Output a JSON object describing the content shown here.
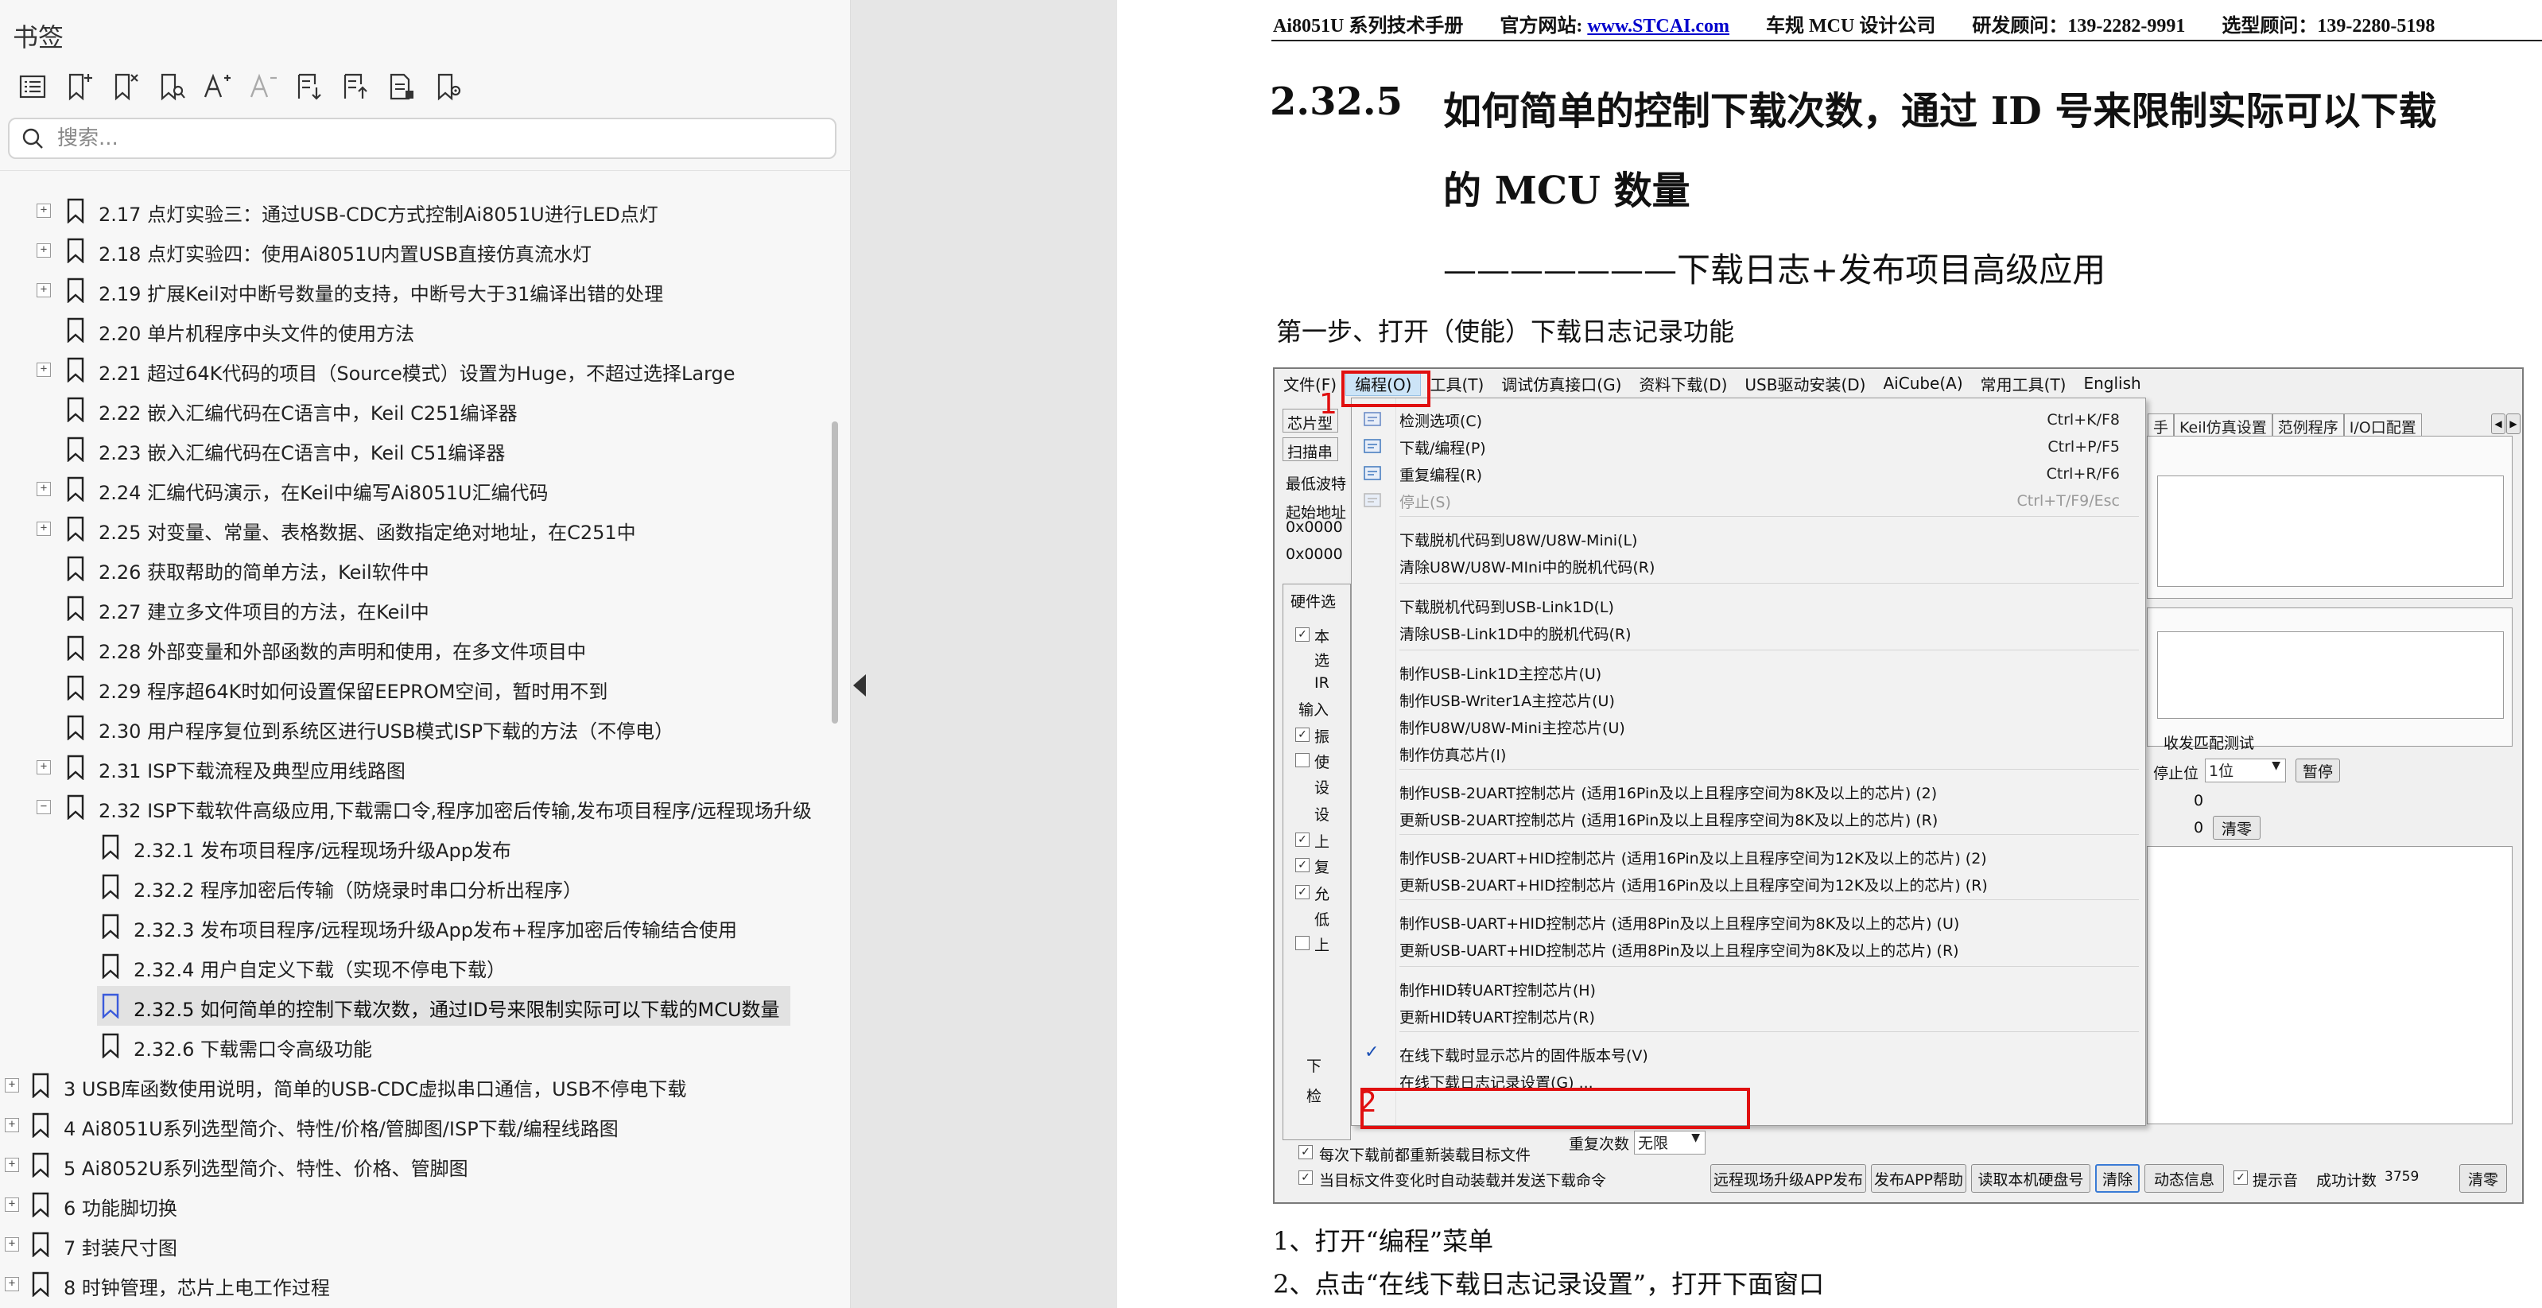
{
  "sidebar": {
    "title": "书签",
    "search_placeholder": "搜索...",
    "toolbar_icons": [
      "outline-list-icon",
      "add-bookmark-icon",
      "delete-bookmark-icon",
      "find-bookmark-icon",
      "increase-font-icon",
      "decrease-font-icon",
      "expand-all-icon",
      "collapse-all-icon",
      "bookmark-properties-icon",
      "bookmark-settings-icon"
    ],
    "items": [
      {
        "label": "2.17  点灯实验三：通过USB-CDC方式控制Ai8051U进行LED点灯",
        "level": 1,
        "expander": "+"
      },
      {
        "label": "2.18  点灯实验四：使用Ai8051U内置USB直接仿真流水灯",
        "level": 1,
        "expander": "+"
      },
      {
        "label": "2.19  扩展Keil对中断号数量的支持，中断号大于31编译出错的处理",
        "level": 1,
        "expander": "+"
      },
      {
        "label": "2.20  单片机程序中头文件的使用方法",
        "level": 1,
        "expander": ""
      },
      {
        "label": "2.21  超过64K代码的项目（Source模式）设置为Huge，不超过选择Large",
        "level": 1,
        "expander": "+"
      },
      {
        "label": "2.22  嵌入汇编代码在C语言中，Keil C251编译器",
        "level": 1,
        "expander": ""
      },
      {
        "label": "2.23  嵌入汇编代码在C语言中，Keil C51编译器",
        "level": 1,
        "expander": ""
      },
      {
        "label": "2.24  汇编代码演示，在Keil中编写Ai8051U汇编代码",
        "level": 1,
        "expander": "+"
      },
      {
        "label": "2.25  对变量、常量、表格数据、函数指定绝对地址，在C251中",
        "level": 1,
        "expander": "+"
      },
      {
        "label": "2.26  获取帮助的简单方法，Keil软件中",
        "level": 1,
        "expander": ""
      },
      {
        "label": "2.27  建立多文件项目的方法，在Keil中",
        "level": 1,
        "expander": ""
      },
      {
        "label": "2.28 外部变量和外部函数的声明和使用，在多文件项目中",
        "level": 1,
        "expander": ""
      },
      {
        "label": "2.29  程序超64K时如何设置保留EEPROM空间，暂时用不到",
        "level": 1,
        "expander": ""
      },
      {
        "label": "2.30  用户程序复位到系统区进行USB模式ISP下载的方法（不停电）",
        "level": 1,
        "expander": ""
      },
      {
        "label": "2.31  ISP下载流程及典型应用线路图",
        "level": 1,
        "expander": "+"
      },
      {
        "label": "2.32  ISP下载软件高级应用,下载需口令,程序加密后传输,发布项目程序/远程现场升级",
        "level": 1,
        "expander": "−"
      },
      {
        "label": "2.32.1 发布项目程序/远程现场升级App发布",
        "level": 2,
        "expander": ""
      },
      {
        "label": "2.32.2 程序加密后传输（防烧录时串口分析出程序）",
        "level": 2,
        "expander": ""
      },
      {
        "label": "2.32.3  发布项目程序/远程现场升级App发布+程序加密后传输结合使用",
        "level": 2,
        "expander": ""
      },
      {
        "label": "2.32.4 用户自定义下载（实现不停电下载）",
        "level": 2,
        "expander": ""
      },
      {
        "label": "2.32.5  如何简单的控制下载次数，通过ID号来限制实际可以下载的MCU数量",
        "level": 2,
        "expander": "",
        "selected": true
      },
      {
        "label": "2.32.6  下载需口令高级功能",
        "level": 2,
        "expander": ""
      },
      {
        "label": "3  USB库函数使用说明，简单的USB-CDC虚拟串口通信，USB不停电下载",
        "level": 0,
        "expander": "+"
      },
      {
        "label": "4  Ai8051U系列选型简介、特性/价格/管脚图/ISP下载/编程线路图",
        "level": 0,
        "expander": "+"
      },
      {
        "label": "5  Ai8052U系列选型简介、特性、价格、管脚图",
        "level": 0,
        "expander": "+"
      },
      {
        "label": "6  功能脚切换",
        "level": 0,
        "expander": "+"
      },
      {
        "label": "7  封装尺寸图",
        "level": 0,
        "expander": "+"
      },
      {
        "label": "8  时钟管理，芯片上电工作过程",
        "level": 0,
        "expander": "+"
      }
    ]
  },
  "doc": {
    "header": {
      "manual": "Ai8051U 系列技术手册",
      "site_label": "官方网站:",
      "site_url": "www.STCAI.com",
      "company": "车规 MCU 设计公司",
      "rd_phone": "研发顾问：139-2282-9991",
      "sel_phone": "选型顾问：139-2280-5198"
    },
    "section_number": "2.32.5",
    "title_line1": "如何简单的控制下载次数，通过 ID 号来限制实际可以下载",
    "title_line2": "的 MCU 数量",
    "subtitle": "———————下载日志+发布项目高级应用",
    "step1": "第一步、打开（使能）下载日志记录功能",
    "footnote1": "1、打开“编程”菜单",
    "footnote2": "2、点击“在线下载日志记录设置”，打开下面窗口"
  },
  "screenshot": {
    "menubar": [
      "文件(F)",
      "编程(O)",
      "工具(T)",
      "调试仿真接口(G)",
      "资料下载(D)",
      "USB驱动安装(D)",
      "AiCube(A)",
      "常用工具(T)",
      "English"
    ],
    "menu_items": [
      {
        "label": "检测选项(C)",
        "shortcut": "Ctrl+K/F8"
      },
      {
        "label": "下载/编程(P)",
        "shortcut": "Ctrl+P/F5"
      },
      {
        "label": "重复编程(R)",
        "shortcut": "Ctrl+R/F6"
      },
      {
        "label": "停止(S)",
        "shortcut": "Ctrl+T/F9/Esc",
        "disabled": true
      },
      {
        "label": "下载脱机代码到U8W/U8W-Mini(L)"
      },
      {
        "label": "清除U8W/U8W-MIni中的脱机代码(R)"
      },
      {
        "label": "下载脱机代码到USB-Link1D(L)"
      },
      {
        "label": "清除USB-Link1D中的脱机代码(R)"
      },
      {
        "label": "制作USB-Link1D主控芯片(U)"
      },
      {
        "label": "制作USB-Writer1A主控芯片(U)"
      },
      {
        "label": "制作U8W/U8W-Mini主控芯片(U)"
      },
      {
        "label": "制作仿真芯片(I)"
      },
      {
        "label": "制作USB-2UART控制芯片 (适用16Pin及以上且程序空间为8K及以上的芯片) (2)"
      },
      {
        "label": "更新USB-2UART控制芯片 (适用16Pin及以上且程序空间为8K及以上的芯片) (R)"
      },
      {
        "label": "制作USB-2UART+HID控制芯片 (适用16Pin及以上且程序空间为12K及以上的芯片) (2)"
      },
      {
        "label": "更新USB-2UART+HID控制芯片 (适用16Pin及以上且程序空间为12K及以上的芯片) (R)"
      },
      {
        "label": "制作USB-UART+HID控制芯片 (适用8Pin及以上且程序空间为8K及以上的芯片) (U)"
      },
      {
        "label": "更新USB-UART+HID控制芯片 (适用8Pin及以上且程序空间为8K及以上的芯片) (R)"
      },
      {
        "label": "制作HID转UART控制芯片(H)"
      },
      {
        "label": "更新HID转UART控制芯片(R)"
      },
      {
        "label": "在线下载时显示芯片的固件版本号(V)",
        "checked": true
      },
      {
        "label": "在线下载日志记录设置(G) ..."
      }
    ],
    "left_fragments": [
      "芯片型",
      "扫描串",
      "最低波特",
      "起始地址",
      "0x0000",
      "0x0000",
      "硬件选",
      "本",
      "选",
      "IR",
      "输入",
      "振",
      "使",
      "设",
      "设",
      "上",
      "复",
      "允",
      "低",
      "上",
      "下",
      "检"
    ],
    "right_tabs": [
      "手",
      "Keil仿真设置",
      "范例程序",
      "I/O口配置"
    ],
    "right_labels": {
      "match": "收发匹配测试",
      "stopbits": "停止位",
      "stopbits_val": "1位",
      "pause": "暂停",
      "zero1": "0",
      "zero2": "0",
      "clear_btn": "清零"
    },
    "bottom": {
      "reload": "每次下载前都重新装载目标文件",
      "auto_send": "当目标文件变化时自动装载并发送下载命令",
      "repeat_label": "重复次数",
      "repeat_val": "无限",
      "btn_remote": "远程现场升级APP发布",
      "btn_help": "发布APP帮助",
      "btn_disk": "读取本机硬盘号",
      "btn_clear": "清除",
      "btn_anim": "动态信息",
      "prompt": "提示音",
      "success_label": "成功计数",
      "success_val": "3759",
      "btn_zero": "清零"
    },
    "annotations": {
      "one": "1",
      "two": "2"
    }
  },
  "colors": {
    "annotation_red": "#e01010",
    "link_blue": "#0000cc",
    "menu_highlight": "#cce4f7"
  }
}
